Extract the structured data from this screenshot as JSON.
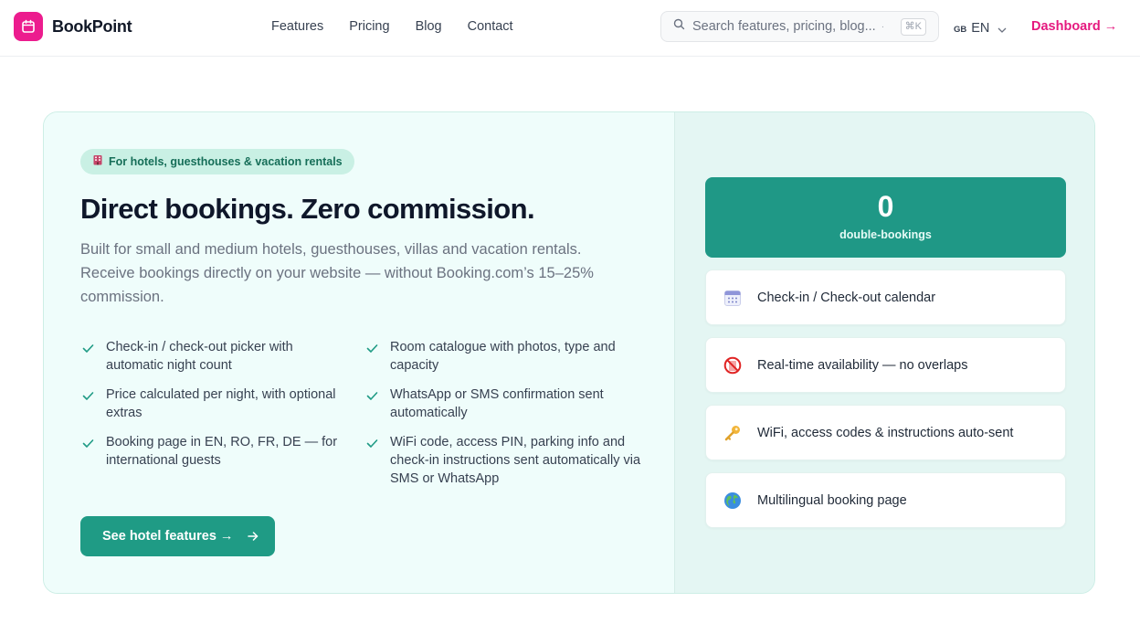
{
  "header": {
    "brand": "BookPoint",
    "nav": [
      {
        "label": "Features"
      },
      {
        "label": "Pricing"
      },
      {
        "label": "Blog"
      },
      {
        "label": "Contact"
      }
    ],
    "search": {
      "placeholder": "Search features, pricing, blog...",
      "shortcut": "⌘K"
    },
    "language": {
      "flag": "GB",
      "code": "EN"
    },
    "dashboard_label": "Dashboard →"
  },
  "hero": {
    "badge": "For hotels, guesthouses & vacation rentals",
    "badge_icon": "hotel-icon",
    "title": "Direct bookings. Zero commission.",
    "lead": "Built for small and medium hotels, guesthouses, villas and vacation rentals. Receive bookings directly on your website — without Booking.com’s 15–25% commission.",
    "features": [
      {
        "text": "Check-in / check-out picker with automatic night count"
      },
      {
        "text": "Room catalogue with photos, type and capacity"
      },
      {
        "text": "Price calculated per night, with optional extras"
      },
      {
        "text": "WhatsApp or SMS confirmation sent automatically"
      },
      {
        "text": "Booking page in EN, RO, FR, DE — for international guests"
      },
      {
        "text": "WiFi code, access PIN, parking info and check-in instructions sent automatically via SMS or WhatsApp"
      }
    ],
    "cta_label": "See hotel features →"
  },
  "panel": {
    "stat": {
      "value": "0",
      "label": "double-bookings"
    },
    "items": [
      {
        "label": "Check-in / Check-out calendar",
        "icon": "calendar-icon"
      },
      {
        "label": "Real-time availability — no overlaps",
        "icon": "no-entry-icon"
      },
      {
        "label": "WiFi, access codes & instructions auto-sent",
        "icon": "key-icon"
      },
      {
        "label": "Multilingual booking page",
        "icon": "globe-icon"
      }
    ]
  },
  "colors": {
    "brand": "#ec1c8e",
    "accent": "#1f9b85",
    "dashboard_link": "#e5197f"
  }
}
